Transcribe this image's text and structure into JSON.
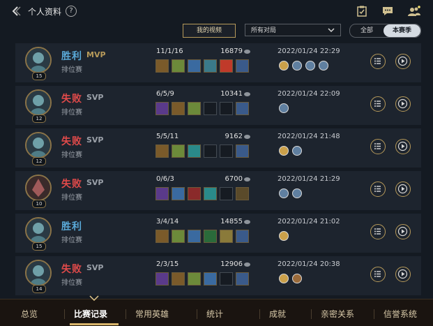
{
  "header": {
    "title": "个人资料",
    "help_icon": "?"
  },
  "filters": {
    "my_videos": "我的视频",
    "match_type": "所有对局",
    "season_all": "全部",
    "season_current": "本赛季"
  },
  "matches": [
    {
      "result": "胜利",
      "result_type": "win",
      "mvp": "MVP",
      "mvp_color": "#b79a5a",
      "mode": "排位赛",
      "kda": "11/1/16",
      "gold": "16879",
      "date": "2022/01/24 22:29",
      "level": "15",
      "items": [
        "#7a5a2a",
        "#6c8a3a",
        "#3a6aa0",
        "#3a7a8a",
        "#c03a2a",
        "#3a5a8a"
      ],
      "badges": [
        "#caa04a",
        "#5f7fa0",
        "#5f7fa0",
        "#5f7fa0"
      ]
    },
    {
      "result": "失败",
      "result_type": "loss",
      "mvp": "SVP",
      "mvp_color": "#9aa0a8",
      "mode": "排位赛",
      "kda": "6/5/9",
      "gold": "10341",
      "date": "2022/01/24 22:09",
      "level": "12",
      "items": [
        "#5a3a8a",
        "#7a5a2a",
        "#6c8a3a",
        "",
        "",
        "#3a5a8a"
      ],
      "badges": [
        "#5f7fa0"
      ]
    },
    {
      "result": "失败",
      "result_type": "loss",
      "mvp": "SVP",
      "mvp_color": "#9aa0a8",
      "mode": "排位赛",
      "kda": "5/5/11",
      "gold": "9162",
      "date": "2022/01/24 21:48",
      "level": "12",
      "items": [
        "#7a5a2a",
        "#6c8a3a",
        "#2a8a8a",
        "",
        "",
        "#3a5a8a"
      ],
      "badges": [
        "#caa04a",
        "#5f7fa0"
      ]
    },
    {
      "result": "失败",
      "result_type": "loss",
      "mvp": "SVP",
      "mvp_color": "#9aa0a8",
      "mode": "排位赛",
      "kda": "0/6/3",
      "gold": "6700",
      "date": "2022/01/24 21:29",
      "level": "10",
      "items": [
        "#5a3a8a",
        "#3a6aa0",
        "#8a2a2a",
        "#2a8a8a",
        "",
        "#5a4a2a"
      ],
      "badges": [
        "#5f7fa0",
        "#5f7fa0"
      ]
    },
    {
      "result": "胜利",
      "result_type": "win",
      "mvp": "",
      "mvp_color": "#9aa0a8",
      "mode": "排位赛",
      "kda": "3/4/14",
      "gold": "14855",
      "date": "2022/01/24 21:02",
      "level": "15",
      "items": [
        "#7a5a2a",
        "#6c8a3a",
        "#3a6aa0",
        "#2a6a3a",
        "#8a7a3a",
        "#3a5a8a"
      ],
      "badges": [
        "#caa04a"
      ]
    },
    {
      "result": "失败",
      "result_type": "loss",
      "mvp": "SVP",
      "mvp_color": "#9aa0a8",
      "mode": "排位赛",
      "kda": "2/3/15",
      "gold": "12906",
      "date": "2022/01/24 20:38",
      "level": "14",
      "items": [
        "#5a3a8a",
        "#7a5a2a",
        "#6c8a3a",
        "#3a6aa0",
        "",
        "#3a5a8a"
      ],
      "badges": [
        "#caa04a",
        "#9a6a3a"
      ]
    }
  ],
  "bottom_tabs": [
    "总览",
    "比赛记录",
    "常用英雄",
    "统计",
    "成就",
    "亲密关系",
    "信誉系统"
  ],
  "active_tab": "比赛记录"
}
